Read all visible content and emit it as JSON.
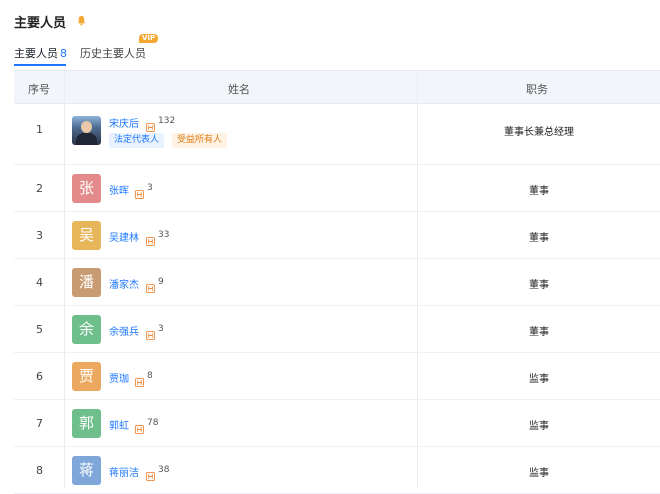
{
  "header": {
    "title": "主要人员"
  },
  "tabs": [
    {
      "label": "主要人员",
      "count": "8"
    },
    {
      "label": "历史主要人员",
      "badge": "VIP"
    }
  ],
  "table": {
    "headers": {
      "index": "序号",
      "name": "姓名",
      "position": "职务"
    },
    "rows": [
      {
        "index": "1",
        "avatar": "",
        "name": "宋庆后",
        "share_count": "132",
        "tags": [
          "法定代表人",
          "受益所有人"
        ],
        "position": "董事长兼总经理",
        "avatar_color": "photo"
      },
      {
        "index": "2",
        "avatar": "张",
        "name": "张晖",
        "share_count": "3",
        "position": "董事",
        "avatar_color": "#e38b8b"
      },
      {
        "index": "3",
        "avatar": "吴",
        "name": "吴建林",
        "share_count": "33",
        "position": "董事",
        "avatar_color": "#e8b65a"
      },
      {
        "index": "4",
        "avatar": "潘",
        "name": "潘家杰",
        "share_count": "9",
        "position": "董事",
        "avatar_color": "#c99b72"
      },
      {
        "index": "5",
        "avatar": "余",
        "name": "余强兵",
        "share_count": "3",
        "position": "董事",
        "avatar_color": "#6fbf8c"
      },
      {
        "index": "6",
        "avatar": "贾",
        "name": "贾珈",
        "share_count": "8",
        "position": "监事",
        "avatar_color": "#eaa95f"
      },
      {
        "index": "7",
        "avatar": "郭",
        "name": "郭虹",
        "share_count": "78",
        "position": "监事",
        "avatar_color": "#6fbf8c"
      },
      {
        "index": "8",
        "avatar": "蒋",
        "name": "蒋丽洁",
        "share_count": "38",
        "position": "监事",
        "avatar_color": "#7fa6d9"
      }
    ]
  },
  "colors": {
    "accent": "#1e78ff",
    "vip": "#f5a833",
    "share_icon": "#f08a3c"
  }
}
